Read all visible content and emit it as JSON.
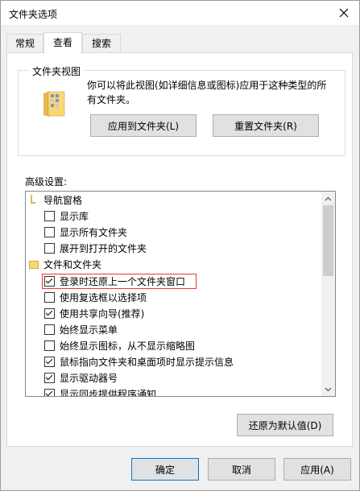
{
  "window": {
    "title": "文件夹选项"
  },
  "tabs": [
    {
      "label": "常规"
    },
    {
      "label": "查看"
    },
    {
      "label": "搜索"
    }
  ],
  "folder_views": {
    "group_label": "文件夹视图",
    "description": "你可以将此视图(如详细信息或图标)应用于这种类型的所有文件夹。",
    "apply_button": "应用到文件夹(L)",
    "reset_button": "重置文件夹(R)"
  },
  "advanced": {
    "label": "高级设置:",
    "items": [
      {
        "type": "category",
        "label": "导航窗格",
        "icon": "navigation-pane-icon"
      },
      {
        "type": "checkbox",
        "label": "显示库",
        "checked": false
      },
      {
        "type": "checkbox",
        "label": "显示所有文件夹",
        "checked": false
      },
      {
        "type": "checkbox",
        "label": "展开到打开的文件夹",
        "checked": false
      },
      {
        "type": "category",
        "label": "文件和文件夹",
        "icon": "folder-icon"
      },
      {
        "type": "checkbox",
        "label": "登录时还原上一个文件夹窗口",
        "checked": true,
        "highlighted": true
      },
      {
        "type": "checkbox",
        "label": "使用复选框以选择项",
        "checked": false
      },
      {
        "type": "checkbox",
        "label": "使用共享向导(推荐)",
        "checked": true
      },
      {
        "type": "checkbox",
        "label": "始终显示菜单",
        "checked": false
      },
      {
        "type": "checkbox",
        "label": "始终显示图标，从不显示缩略图",
        "checked": false
      },
      {
        "type": "checkbox",
        "label": "鼠标指向文件夹和桌面项时显示提示信息",
        "checked": true
      },
      {
        "type": "checkbox",
        "label": "显示驱动器号",
        "checked": true
      },
      {
        "type": "checkbox",
        "label": "显示同步提供程序通知",
        "checked": true
      }
    ],
    "restore_defaults_button": "还原为默认值(D)"
  },
  "footer": {
    "ok": "确定",
    "cancel": "取消",
    "apply": "应用(A)"
  },
  "colors": {
    "highlight_border": "#e53935",
    "focus_border": "#0078d7"
  }
}
